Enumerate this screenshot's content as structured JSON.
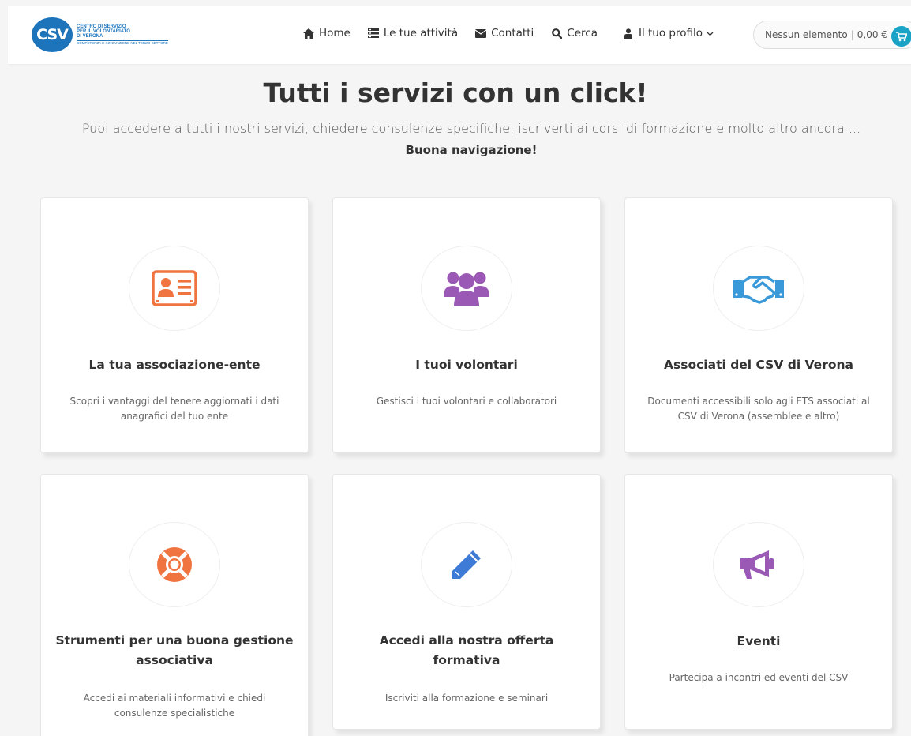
{
  "header": {
    "logo_mark": "CSV",
    "logo_lines": [
      "CENTRO DI SERVIZIO",
      "PER IL VOLONTARIATO",
      "DI VERONA"
    ],
    "logo_tagline": "COMPETENZA E INNOVAZIONE NEL TERZO SETTORE",
    "nav": [
      {
        "label": "Home",
        "icon": "home-icon"
      },
      {
        "label": "Le tue attività",
        "icon": "list-icon"
      },
      {
        "label": "Contatti",
        "icon": "envelope-icon"
      },
      {
        "label": "Cerca",
        "icon": "search-icon"
      },
      {
        "label": "Il tuo profilo",
        "icon": "user-icon"
      }
    ],
    "cart": {
      "items": "Nessun elemento",
      "total": "0,00 €"
    }
  },
  "hero": {
    "title": "Tutti i servizi con un click!",
    "subtitle": "Puoi accedere a tutti i nostri servizi, chiedere consulenze specifiche, iscriverti ai corsi di formazione e molto altro ancora ...",
    "strong": "Buona navigazione!"
  },
  "cards": [
    {
      "title": "La tua associazione-ente",
      "desc": "Scopri i vantaggi del tenere aggiornati i dati anagrafici del tuo ente",
      "icon": "id-card-icon",
      "color": "#f0743f"
    },
    {
      "title": "I tuoi volontari",
      "desc": "Gestisci i tuoi volontari e collaboratori",
      "icon": "users-icon",
      "color": "#9b59b6"
    },
    {
      "title": "Associati del CSV di Verona",
      "desc": "Documenti accessibili solo agli ETS associati al CSV di Verona (assemblee e altro)",
      "icon": "handshake-icon",
      "color": "#3a9ad9"
    },
    {
      "title": "Strumenti per una buona gestione associativa",
      "desc": "Accedi ai materiali informativi e chiedi consulenze specialistiche",
      "icon": "life-ring-icon",
      "color": "#f0743f"
    },
    {
      "title": "Accedi alla nostra offerta formativa",
      "desc": "Iscriviti alla formazione e seminari",
      "icon": "pencil-icon",
      "color": "#3d7bd6"
    },
    {
      "title": "Eventi",
      "desc": "Partecipa a incontri ed eventi del CSV",
      "icon": "megaphone-icon",
      "color": "#9b59b6"
    }
  ]
}
